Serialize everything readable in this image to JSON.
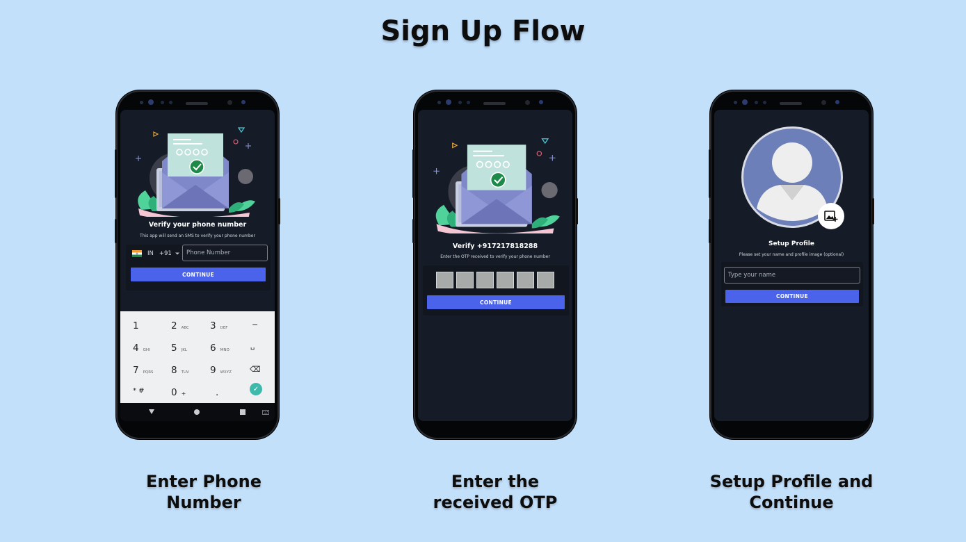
{
  "page": {
    "title": "Sign Up Flow"
  },
  "steps": [
    {
      "caption": "Enter Phone Number",
      "screen": {
        "heading": "Verify your phone number",
        "subtext": "This app will send an SMS to verify your phone number",
        "country_code": "IN",
        "dial_code": "+91",
        "phone_placeholder": "Phone Number",
        "continue_label": "CONTINUE",
        "keypad": [
          {
            "digit": "1",
            "letters": ""
          },
          {
            "digit": "2",
            "letters": "ABC"
          },
          {
            "digit": "3",
            "letters": "DEF"
          },
          {
            "digit": "−",
            "letters": ""
          },
          {
            "digit": "4",
            "letters": "GHI"
          },
          {
            "digit": "5",
            "letters": "JKL"
          },
          {
            "digit": "6",
            "letters": "MNO"
          },
          {
            "digit": "␣",
            "letters": ""
          },
          {
            "digit": "7",
            "letters": "PQRS"
          },
          {
            "digit": "8",
            "letters": "TUV"
          },
          {
            "digit": "9",
            "letters": "WXYZ"
          },
          {
            "digit": "⌫",
            "letters": ""
          },
          {
            "digit": "* #",
            "letters": ""
          },
          {
            "digit": "0",
            "letters": "+"
          },
          {
            "digit": ".",
            "letters": ""
          },
          {
            "digit": "✓",
            "letters": ""
          }
        ]
      }
    },
    {
      "caption": "Enter the received OTP",
      "screen": {
        "heading": "Verify +917217818288",
        "subtext": "Enter the OTP received to verify your phone number",
        "otp_cells": 6,
        "continue_label": "CONTINUE"
      }
    },
    {
      "caption": "Setup Profile and Continue",
      "screen": {
        "heading": "Setup Profile",
        "subtext": "Please set your name and profile image (optional)",
        "name_placeholder": "Type your name",
        "continue_label": "CONTINUE"
      }
    }
  ],
  "colors": {
    "background": "#c3e0fb",
    "screen": "#151c27",
    "accent": "#4b63ea",
    "success": "#1e8a4a"
  },
  "icons": [
    "india-flag-icon",
    "chevron-down-icon",
    "envelope-illustration",
    "checkmark-icon",
    "backspace-icon",
    "add-photo-icon",
    "avatar-placeholder-icon",
    "nav-back-icon",
    "nav-home-icon",
    "nav-recents-icon",
    "keyboard-icon"
  ]
}
